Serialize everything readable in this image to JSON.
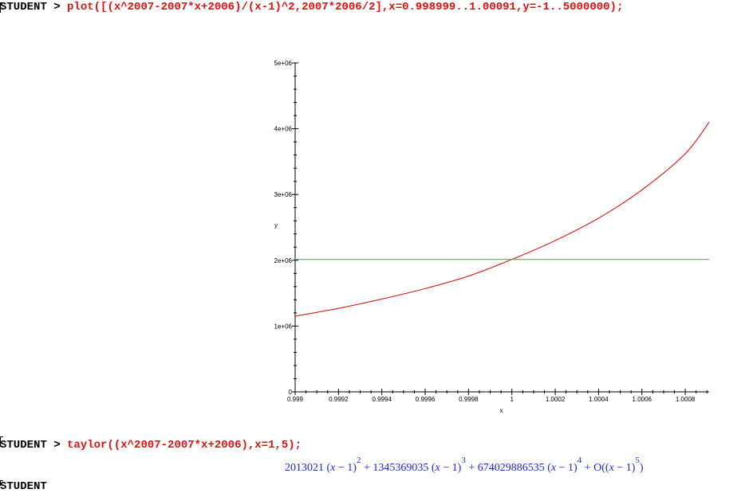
{
  "session": {
    "prompt1": "STUDENT",
    "cmd1": "plot([(x^2007-2007*x+2006)/(x-1)^2,2007*2006/2],x=0.998999..1.00091,y=-1..5000000);",
    "prompt2": "STUDENT",
    "cmd2": "taylor((x^2007-2007*x+2006),x=1,5);",
    "prompt_symbol": ">",
    "colors": {
      "prompt": "#000000",
      "command": "#e01010",
      "output": "#1a2cc8"
    }
  },
  "output": {
    "t1_coef": "2013021",
    "t1_exp": "2",
    "t2_coef": "1345369035",
    "t2_exp": "3",
    "t3_coef": "674029886535",
    "t3_exp": "4",
    "o_exp": "5",
    "var": "x",
    "one": "1",
    "plus": "+",
    "minus": "−",
    "big_o": "O"
  },
  "chart_data": {
    "type": "line",
    "xlabel": "x",
    "ylabel": "y",
    "xlim": [
      0.999,
      1.00091
    ],
    "ylim": [
      -1,
      5000000
    ],
    "xticks": [
      "0.999",
      "0.9992",
      "0.9994",
      "0.9996",
      "0.9998",
      "1",
      "1.0002",
      "1.0004",
      "1.0006",
      "1.0008"
    ],
    "yticks": [
      "0",
      "1e+06",
      "2e+06",
      "3e+06",
      "4e+06",
      "5e+06"
    ],
    "series": [
      {
        "color": "#e00000",
        "x": [
          0.999,
          0.9992,
          0.9994,
          0.9996,
          0.9998,
          1.0,
          1.0002,
          1.0004,
          1.0006,
          1.0008,
          1.00091
        ],
        "y": [
          1150000,
          1270000,
          1410000,
          1570000,
          1760000,
          2013021,
          2300000,
          2640000,
          3070000,
          3620000,
          4100000
        ]
      },
      {
        "color": "#22bb22",
        "x": [
          0.999,
          1.00091
        ],
        "y": [
          2013021,
          2013021
        ]
      }
    ]
  }
}
